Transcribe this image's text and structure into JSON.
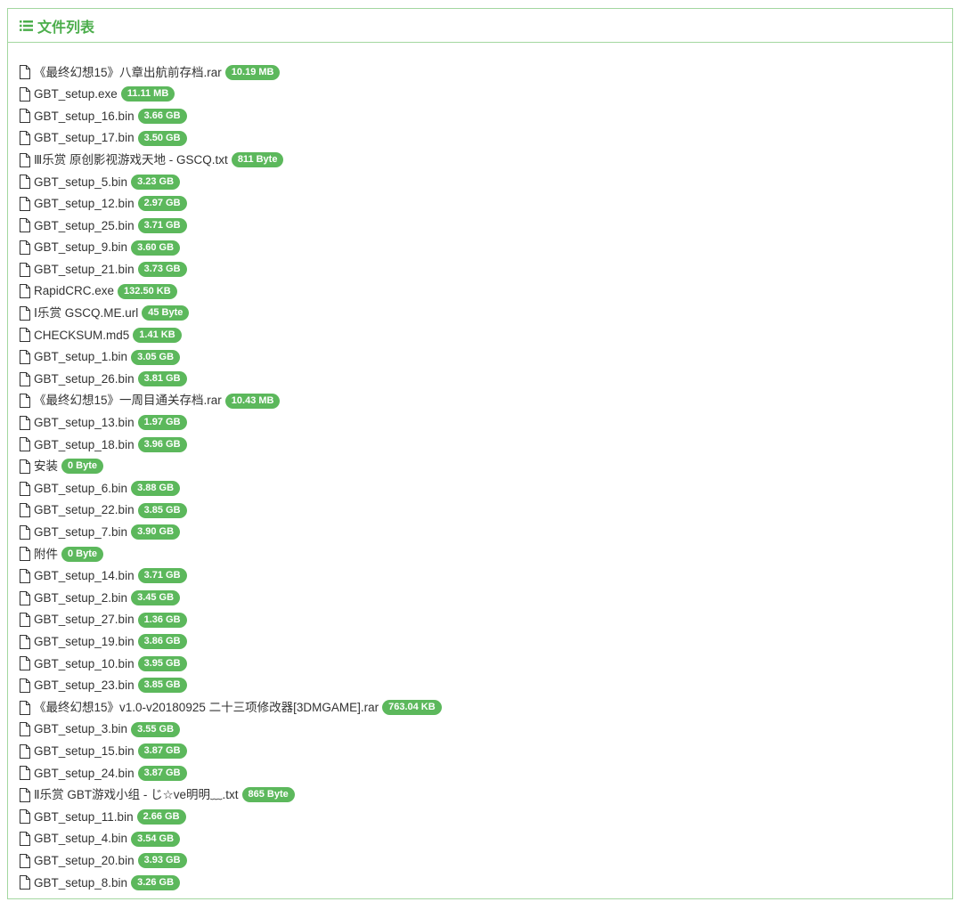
{
  "panel": {
    "title": "文件列表",
    "title_icon": "list-icon",
    "accent_color": "#4cae4c",
    "badge_color": "#5cb85c",
    "border_color": "#a3d7a0"
  },
  "files": [
    {
      "name": "《最终幻想15》八章出航前存档.rar",
      "size": "10.19 MB"
    },
    {
      "name": "GBT_setup.exe",
      "size": "11.11 MB"
    },
    {
      "name": "GBT_setup_16.bin",
      "size": "3.66 GB"
    },
    {
      "name": "GBT_setup_17.bin",
      "size": "3.50 GB"
    },
    {
      "name": "Ⅲ乐赏 原创影视游戏天地 - GSCQ.txt",
      "size": "811 Byte"
    },
    {
      "name": "GBT_setup_5.bin",
      "size": "3.23 GB"
    },
    {
      "name": "GBT_setup_12.bin",
      "size": "2.97 GB"
    },
    {
      "name": "GBT_setup_25.bin",
      "size": "3.71 GB"
    },
    {
      "name": "GBT_setup_9.bin",
      "size": "3.60 GB"
    },
    {
      "name": "GBT_setup_21.bin",
      "size": "3.73 GB"
    },
    {
      "name": "RapidCRC.exe",
      "size": "132.50 KB"
    },
    {
      "name": "Ⅰ乐赏 GSCQ.ME.url",
      "size": "45 Byte"
    },
    {
      "name": "CHECKSUM.md5",
      "size": "1.41 KB"
    },
    {
      "name": "GBT_setup_1.bin",
      "size": "3.05 GB"
    },
    {
      "name": "GBT_setup_26.bin",
      "size": "3.81 GB"
    },
    {
      "name": "《最终幻想15》一周目通关存档.rar",
      "size": "10.43 MB"
    },
    {
      "name": "GBT_setup_13.bin",
      "size": "1.97 GB"
    },
    {
      "name": "GBT_setup_18.bin",
      "size": "3.96 GB"
    },
    {
      "name": "安装",
      "size": "0 Byte"
    },
    {
      "name": "GBT_setup_6.bin",
      "size": "3.88 GB"
    },
    {
      "name": "GBT_setup_22.bin",
      "size": "3.85 GB"
    },
    {
      "name": "GBT_setup_7.bin",
      "size": "3.90 GB"
    },
    {
      "name": "附件",
      "size": "0 Byte"
    },
    {
      "name": "GBT_setup_14.bin",
      "size": "3.71 GB"
    },
    {
      "name": "GBT_setup_2.bin",
      "size": "3.45 GB"
    },
    {
      "name": "GBT_setup_27.bin",
      "size": "1.36 GB"
    },
    {
      "name": "GBT_setup_19.bin",
      "size": "3.86 GB"
    },
    {
      "name": "GBT_setup_10.bin",
      "size": "3.95 GB"
    },
    {
      "name": "GBT_setup_23.bin",
      "size": "3.85 GB"
    },
    {
      "name": "《最终幻想15》v1.0-v20180925 二十三项修改器[3DMGAME].rar",
      "size": "763.04 KB"
    },
    {
      "name": "GBT_setup_3.bin",
      "size": "3.55 GB"
    },
    {
      "name": "GBT_setup_15.bin",
      "size": "3.87 GB"
    },
    {
      "name": "GBT_setup_24.bin",
      "size": "3.87 GB"
    },
    {
      "name": "Ⅱ乐赏 GBT游戏小组 - じ☆ve明明﹏.txt",
      "size": "865 Byte"
    },
    {
      "name": "GBT_setup_11.bin",
      "size": "2.66 GB"
    },
    {
      "name": "GBT_setup_4.bin",
      "size": "3.54 GB"
    },
    {
      "name": "GBT_setup_20.bin",
      "size": "3.93 GB"
    },
    {
      "name": "GBT_setup_8.bin",
      "size": "3.26 GB"
    }
  ]
}
